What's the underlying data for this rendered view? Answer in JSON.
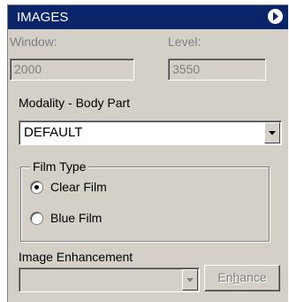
{
  "panel": {
    "title": "IMAGES",
    "collapse_icon": "chevron-right-circle-icon"
  },
  "window_level": {
    "window_label": "Window:",
    "window_value": "2000",
    "level_label": "Level:",
    "level_value": "3550"
  },
  "modality": {
    "label": "Modality - Body Part",
    "selected": "DEFAULT"
  },
  "film_type": {
    "legend": "Film Type",
    "options": [
      {
        "label": "Clear Film",
        "checked": true
      },
      {
        "label": "Blue Film",
        "checked": false
      }
    ]
  },
  "enhancement": {
    "label": "Image Enhancement",
    "selected": "",
    "button_pre": "En",
    "button_accel": "h",
    "button_post": "ance"
  }
}
